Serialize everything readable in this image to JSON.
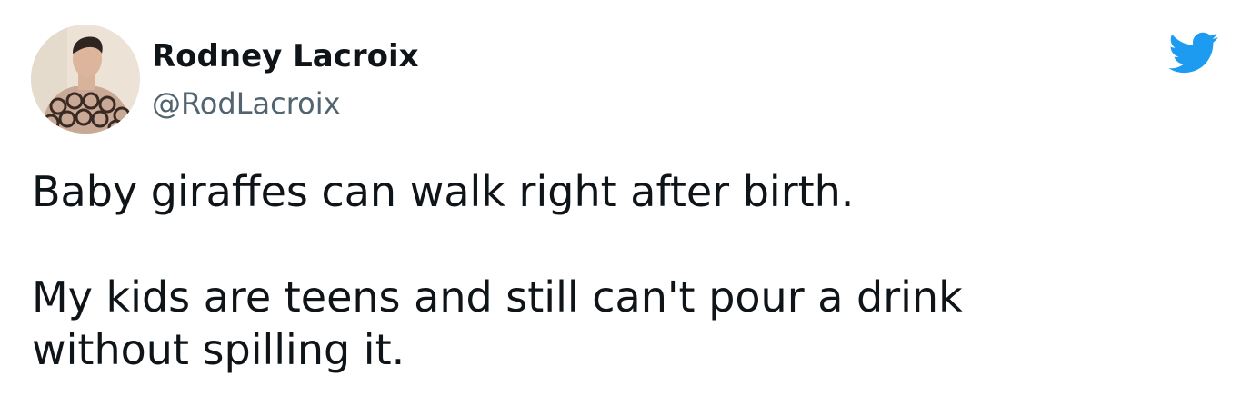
{
  "tweet": {
    "author": {
      "name": "Rodney Lacroix",
      "handle": "@RodLacroix",
      "avatar_icon": "profile-photo"
    },
    "brand_icon": "twitter-bird-icon",
    "brand_color": "#1d9bf0",
    "text_lines": [
      "Baby giraffes can walk right after birth.",
      "My kids are teens and still can't pour a drink",
      "without spilling it."
    ]
  }
}
